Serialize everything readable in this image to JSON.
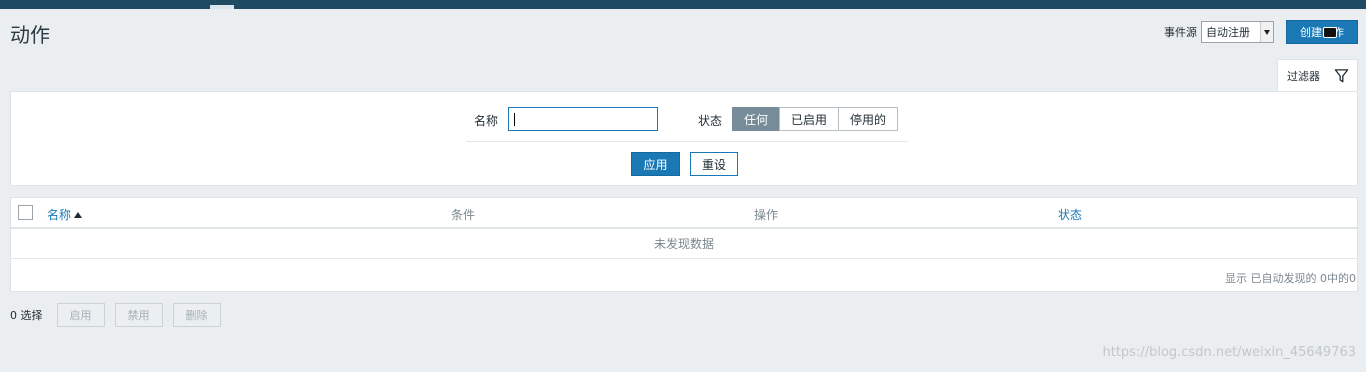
{
  "page": {
    "title": "动作"
  },
  "header": {
    "source_label": "事件源",
    "source_select": {
      "value": "自动注册"
    },
    "create_button": "创建动作"
  },
  "filter": {
    "tab_label": "过滤器",
    "name_label": "名称",
    "name_value": "",
    "status_label": "状态",
    "status_options": [
      "任何",
      "已启用",
      "停用的"
    ],
    "status_selected": "任何",
    "apply_button": "应用",
    "reset_button": "重设"
  },
  "table": {
    "columns": {
      "name": "名称",
      "conditions": "条件",
      "operations": "操作",
      "status": "状态"
    },
    "empty_message": "未发现数据",
    "summary": "显示 已自动发现的 0中的0"
  },
  "bulk_actions": {
    "selected_count": "0 选择",
    "enable": "启用",
    "disable": "禁用",
    "delete": "删除"
  },
  "watermark": "https://blog.csdn.net/weixin_45649763",
  "colors": {
    "accent": "#1a79b5",
    "nav": "#1f4a64",
    "background": "#ebeef0"
  }
}
